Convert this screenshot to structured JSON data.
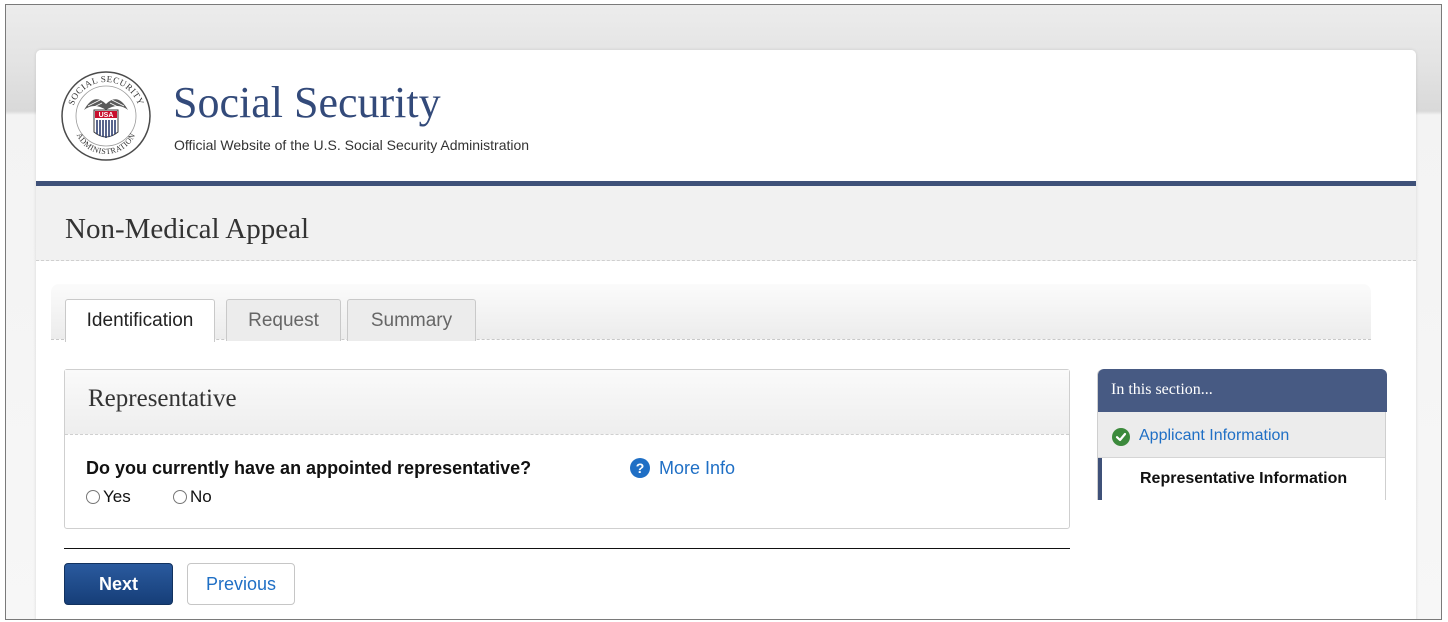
{
  "header": {
    "title": "Social Security",
    "subtitle": "Official Website of the U.S. Social Security Administration",
    "seal": {
      "text_top": "SOCIAL SECURITY",
      "text_bottom": "ADMINISTRATION",
      "badge": "USA"
    }
  },
  "page": {
    "title": "Non-Medical Appeal"
  },
  "tabs": [
    {
      "label": "Identification",
      "active": true
    },
    {
      "label": "Request",
      "active": false
    },
    {
      "label": "Summary",
      "active": false
    }
  ],
  "panel": {
    "title": "Representative",
    "question": "Do you currently have an appointed representative?",
    "more_info": "More Info",
    "help_icon": "question-circle-icon",
    "options": [
      {
        "label": "Yes",
        "selected": false
      },
      {
        "label": "No",
        "selected": false
      }
    ]
  },
  "buttons": {
    "next": "Next",
    "previous": "Previous"
  },
  "sidebar": {
    "title": "In this section...",
    "items": [
      {
        "label": "Applicant Information",
        "status": "complete",
        "icon": "check-circle-icon"
      },
      {
        "label": "Representative Information",
        "status": "current"
      }
    ]
  },
  "colors": {
    "brand_blue": "#334a7a",
    "link_blue": "#1f6fc5",
    "button_blue": "#1b4a8c",
    "complete_green": "#3c8a3c"
  }
}
